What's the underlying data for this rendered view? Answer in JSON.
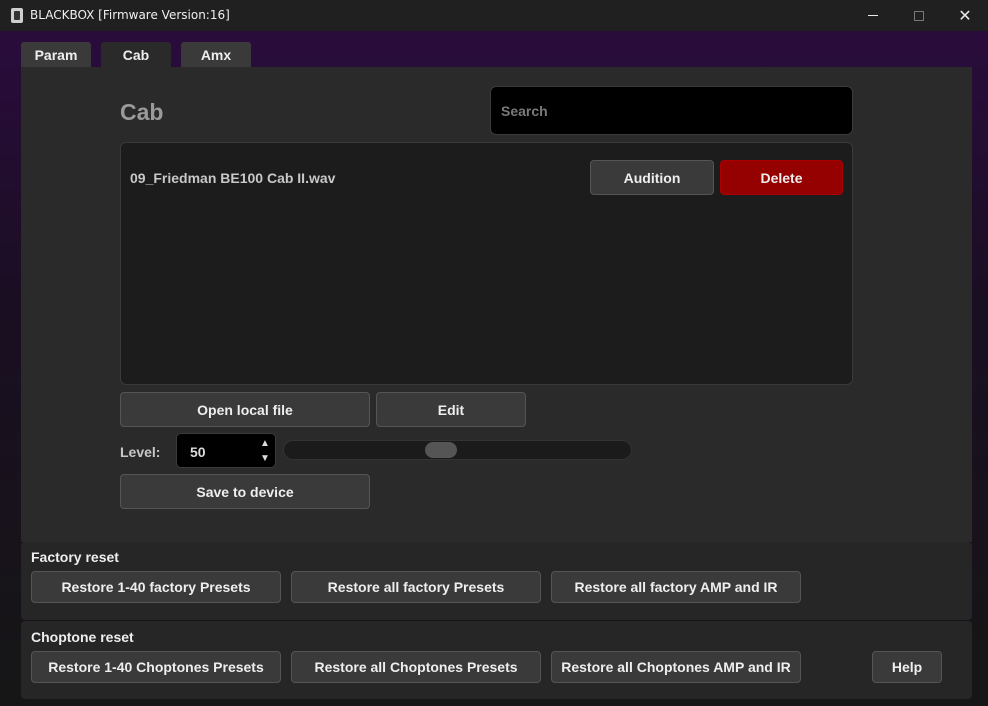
{
  "window": {
    "title": "BLACKBOX [Firmware Version:16]",
    "minimize": "",
    "maximize": "",
    "close": "✕"
  },
  "tabs": [
    {
      "label": "Param",
      "active": false
    },
    {
      "label": "Cab",
      "active": true
    },
    {
      "label": "Amx",
      "active": false
    }
  ],
  "cab": {
    "title": "Cab",
    "search_placeholder": "Search",
    "search_value": "",
    "files": [
      {
        "name": "09_Friedman BE100 Cab II.wav",
        "audition_label": "Audition",
        "delete_label": "Delete"
      }
    ],
    "open_local_label": "Open local file",
    "edit_label": "Edit",
    "level_label": "Level:",
    "level_value": "50",
    "level_fraction": 0.5,
    "save_label": "Save to device"
  },
  "factory_reset": {
    "title": "Factory reset",
    "buttons": [
      "Restore 1-40 factory Presets",
      "Restore all factory Presets",
      "Restore all factory AMP and IR"
    ]
  },
  "choptone_reset": {
    "title": "Choptone reset",
    "buttons": [
      "Restore 1-40 Choptones Presets",
      "Restore all Choptones Presets",
      "Restore all Choptones AMP and IR"
    ],
    "help_label": "Help"
  },
  "colors": {
    "delete": "#950000",
    "panel": "#2a2a2a",
    "accent_gradient_top": "#2a0c3c"
  }
}
